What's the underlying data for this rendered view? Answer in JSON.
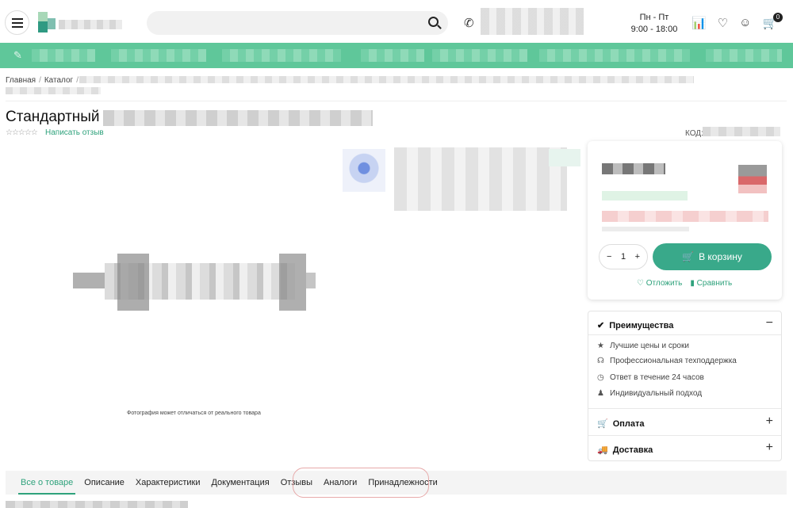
{
  "header": {
    "hours_days": "Пн - Пт",
    "hours_time": "9:00 - 18:00",
    "cart_count": "0"
  },
  "breadcrumbs": [
    "Главная",
    "Каталог"
  ],
  "product": {
    "title_prefix": "Стандартный",
    "stars": "☆☆☆☆☆",
    "review_link": "Написать отзыв",
    "code_label": "КОД:",
    "photo_note": "Фотография может отличаться от реального товара"
  },
  "buy": {
    "qty_minus": "−",
    "qty_value": "1",
    "qty_plus": "+",
    "cart_button": "В корзину",
    "postpone": "Отложить",
    "compare": "Сравнить"
  },
  "advantages": {
    "title": "Преимущества",
    "items": [
      "Лучшие цены и сроки",
      "Профессиональная техподдержка",
      "Ответ в течение 24 часов",
      "Индивидуальный подход"
    ],
    "payment": "Оплата",
    "delivery": "Доставка"
  },
  "tabs": [
    "Все о товаре",
    "Описание",
    "Характеристики",
    "Документация",
    "Отзывы",
    "Аналоги",
    "Принадлежности"
  ],
  "colors": {
    "accent": "#39a98a",
    "nav": "#5fc79a",
    "link": "#2fa27c"
  }
}
